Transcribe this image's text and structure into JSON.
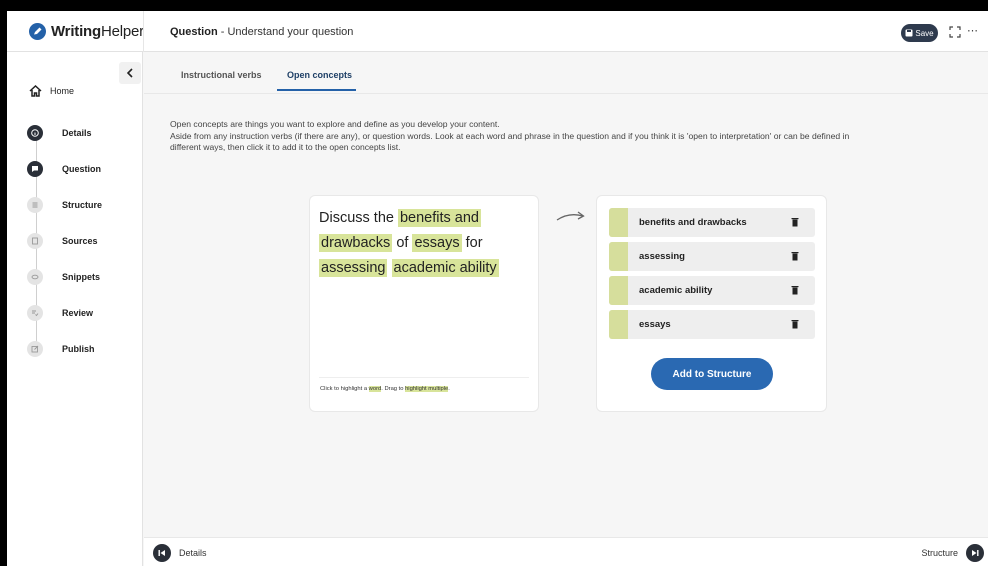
{
  "app": {
    "logo_bold": "Writing",
    "logo_light": "Helper",
    "title_bold": "Question",
    "title_rest": " - Understand your question",
    "save_label": "Save",
    "accent": "#2461a8"
  },
  "sidebar": {
    "home_label": "Home",
    "steps": [
      {
        "label": "Details",
        "icon": "info-icon",
        "state": "active"
      },
      {
        "label": "Question",
        "icon": "chat-icon",
        "state": "active"
      },
      {
        "label": "Structure",
        "icon": "list-icon",
        "state": "inactive"
      },
      {
        "label": "Sources",
        "icon": "book-icon",
        "state": "inactive"
      },
      {
        "label": "Snippets",
        "icon": "link-icon",
        "state": "inactive"
      },
      {
        "label": "Review",
        "icon": "review-icon",
        "state": "inactive"
      },
      {
        "label": "Publish",
        "icon": "publish-icon",
        "state": "inactive"
      }
    ]
  },
  "tabs": [
    {
      "label": "Instructional verbs",
      "active": false
    },
    {
      "label": "Open concepts",
      "active": true
    }
  ],
  "description": {
    "line1": "Open concepts are things you want to explore and define as you develop your content.",
    "line2": "Aside from any instruction verbs (if there are any), or question words. Look at each word and phrase in the question and if you think it is 'open to interpretation' or can be defined in",
    "line3": "different ways, then click it to add it to the open concepts list."
  },
  "question": {
    "w1": "Discuss the ",
    "h1": "benefits and",
    "h2": "drawbacks",
    "w2": " of ",
    "h3": "essays",
    "w3": " for",
    "h4": "assessing",
    "h5": "academic ability",
    "hint_a": "Click to highlight a ",
    "hint_word": "word",
    "hint_b": ". Drag to ",
    "hint_multi": "highlight multiple",
    "hint_c": "."
  },
  "concepts": [
    {
      "label": "benefits and drawbacks"
    },
    {
      "label": "assessing"
    },
    {
      "label": "academic ability"
    },
    {
      "label": "essays"
    }
  ],
  "add_button": "Add to Structure",
  "footer": {
    "prev": "Details",
    "next": "Structure"
  },
  "colors": {
    "highlight": "#d8e49a",
    "concept_bar": "#d6de9c",
    "button": "#2a69b2"
  }
}
